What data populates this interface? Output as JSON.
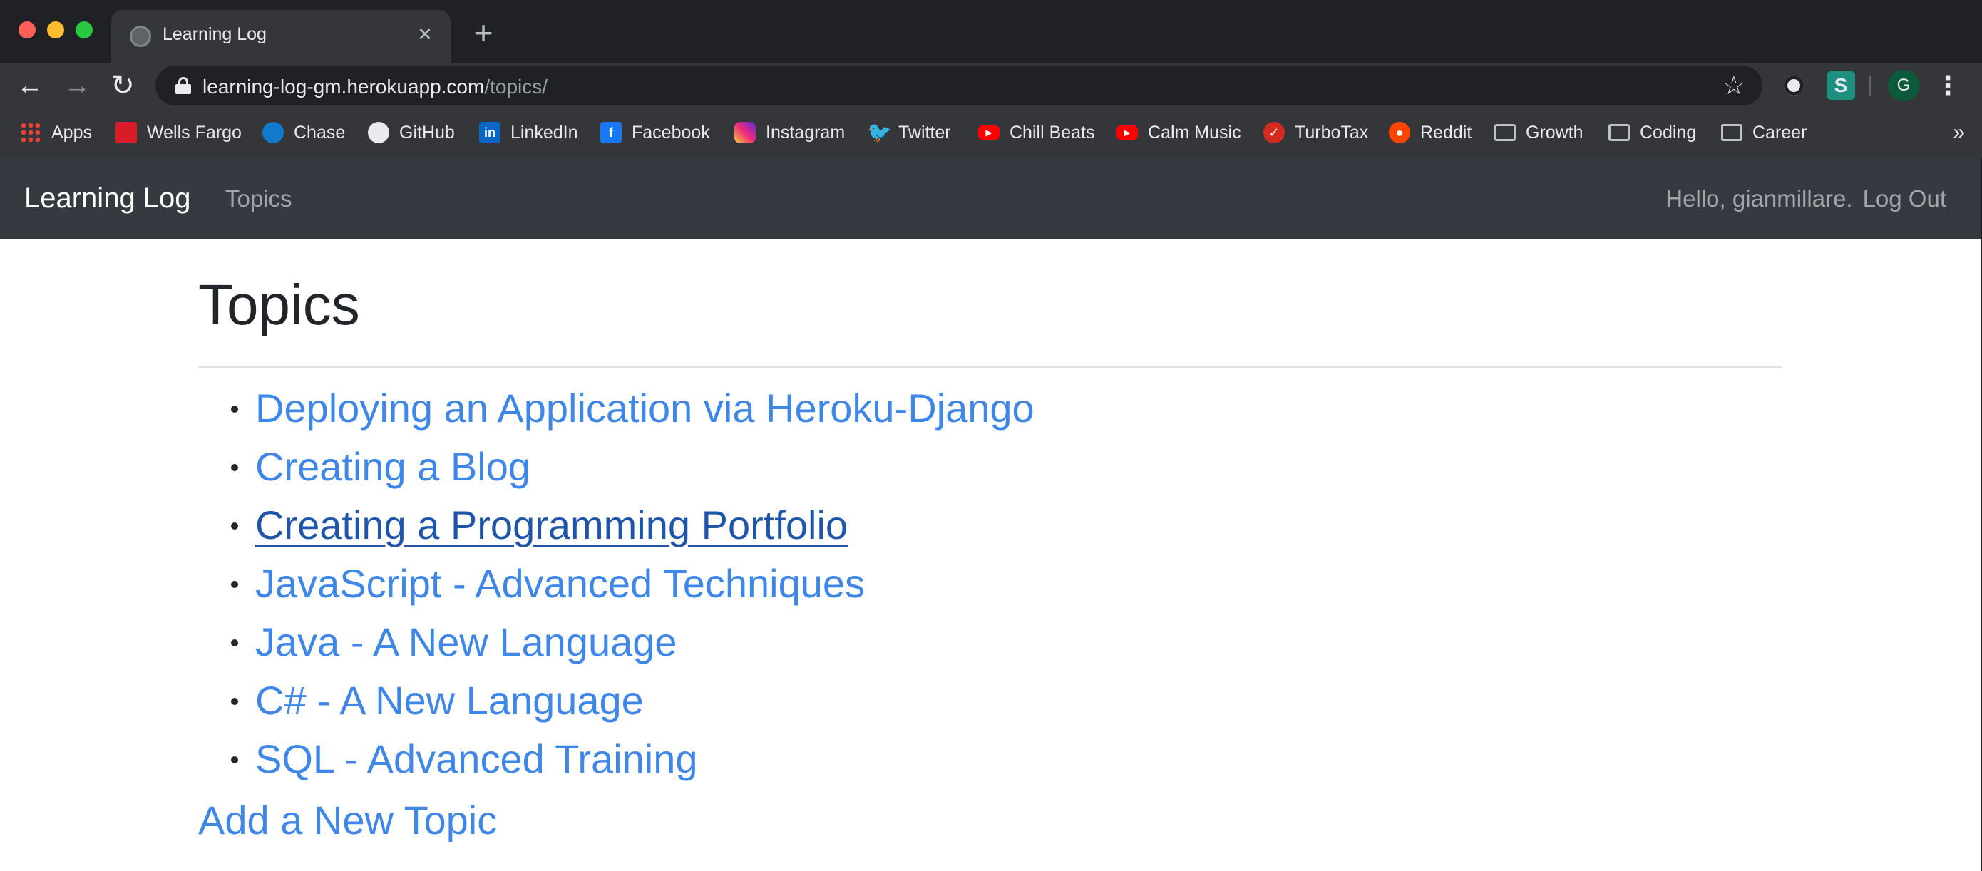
{
  "browser": {
    "tab": {
      "title": "Learning Log",
      "close_glyph": "×"
    },
    "new_tab_glyph": "+",
    "nav": {
      "back_glyph": "←",
      "forward_glyph": "→",
      "reload_glyph": "↻"
    },
    "url": {
      "host": "learning-log-gm.herokuapp.com",
      "path": "/topics/"
    },
    "bookmark_star_glyph": "☆",
    "extension_2_letter": "S",
    "profile_initial": "G",
    "menu_glyph": "⋮",
    "bookmarks": [
      {
        "label": "Apps",
        "icon": "apps-grid-icon"
      },
      {
        "label": "Wells Fargo",
        "icon": "wells-fargo-icon"
      },
      {
        "label": "Chase",
        "icon": "chase-icon"
      },
      {
        "label": "GitHub",
        "icon": "github-icon"
      },
      {
        "label": "LinkedIn",
        "icon": "linkedin-icon"
      },
      {
        "label": "Facebook",
        "icon": "facebook-icon"
      },
      {
        "label": "Instagram",
        "icon": "instagram-icon"
      },
      {
        "label": "Twitter",
        "icon": "twitter-icon"
      },
      {
        "label": "Chill Beats",
        "icon": "youtube-icon"
      },
      {
        "label": "Calm Music",
        "icon": "youtube-icon"
      },
      {
        "label": "TurboTax",
        "icon": "turbotax-icon"
      },
      {
        "label": "Reddit",
        "icon": "reddit-icon"
      },
      {
        "label": "Growth",
        "icon": "folder-icon"
      },
      {
        "label": "Coding",
        "icon": "folder-icon"
      },
      {
        "label": "Career",
        "icon": "folder-icon"
      }
    ],
    "bookmarks_overflow_glyph": "»"
  },
  "site": {
    "brand": "Learning Log",
    "nav_topics": "Topics",
    "greeting": "Hello, gianmillare.",
    "logout": "Log Out"
  },
  "main": {
    "heading": "Topics",
    "topics": [
      "Deploying an Application via Heroku-Django",
      "Creating a Blog",
      "Creating a Programming Portfolio",
      "JavaScript - Advanced Techniques",
      "Java - A New Language",
      "C# - A New Language",
      "SQL - Advanced Training"
    ],
    "hovered_topic_index": 2,
    "add_topic": "Add a New Topic"
  },
  "colors": {
    "link": "#3e86e8",
    "link_hover": "#1f55a8",
    "navbar_bg": "#343a40",
    "chrome_bg": "#35363a"
  }
}
